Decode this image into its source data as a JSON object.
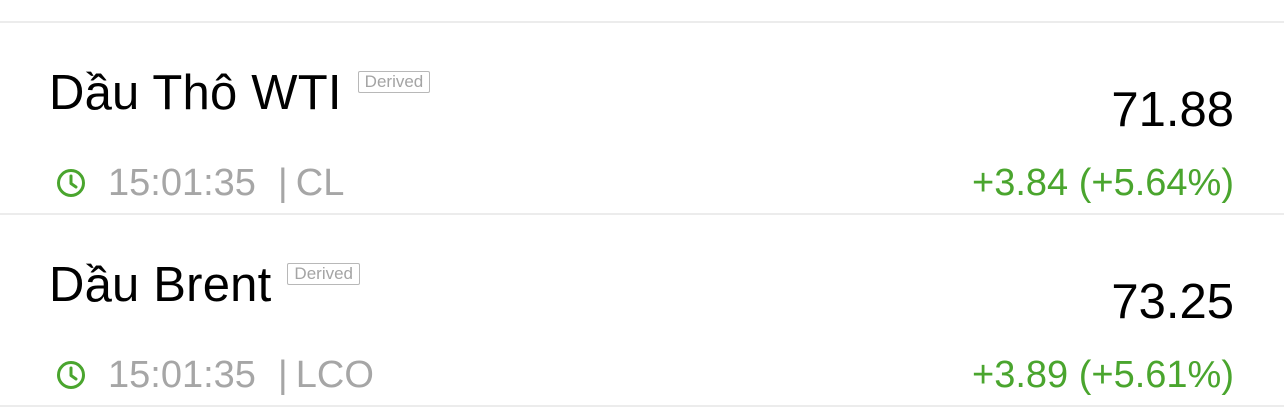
{
  "colors": {
    "positive": "#4aa52e",
    "muted": "#a6a6a6",
    "divider": "#ececec",
    "text": "#000000"
  },
  "icons": {
    "time": "clock-icon"
  },
  "quotes": [
    {
      "name": "Dầu Thô WTI",
      "tag": "Derived",
      "price": "71.88",
      "time": "15:01:35",
      "separator": "|",
      "symbol": "CL",
      "change": "+3.84 (+5.64%)"
    },
    {
      "name": "Dầu Brent",
      "tag": "Derived",
      "price": "73.25",
      "time": "15:01:35",
      "separator": "|",
      "symbol": "LCO",
      "change": "+3.89 (+5.61%)"
    }
  ]
}
